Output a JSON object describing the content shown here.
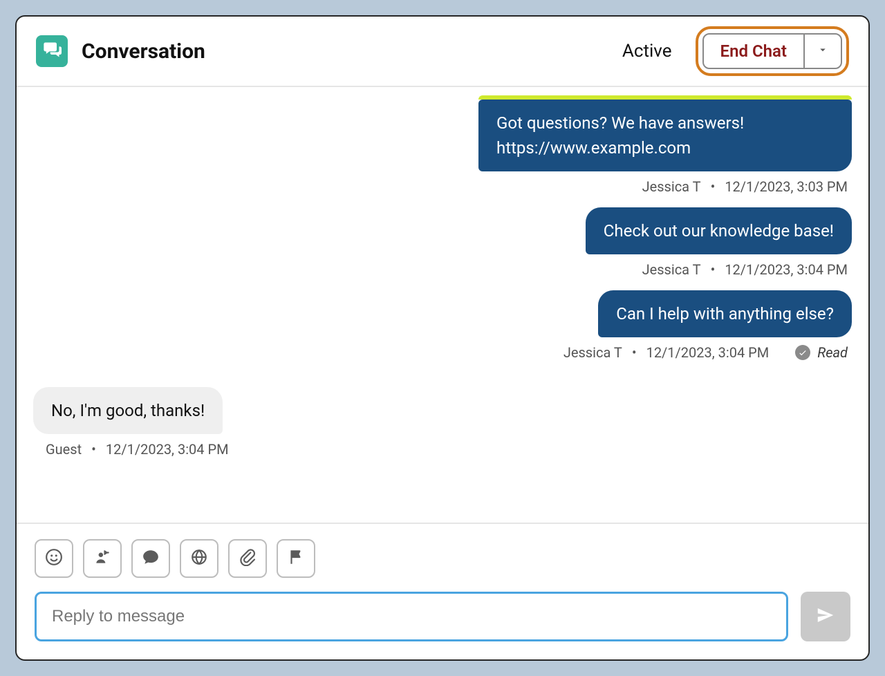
{
  "header": {
    "title": "Conversation",
    "status": "Active",
    "end_chat_label": "End Chat"
  },
  "messages": [
    {
      "side": "agent",
      "first_top": true,
      "text": "Got questions? We have answers! https://www.example.com",
      "author": "Jessica T",
      "timestamp": "12/1/2023, 3:03 PM",
      "read": false
    },
    {
      "side": "agent",
      "text": "Check out our knowledge base!",
      "author": "Jessica T",
      "timestamp": "12/1/2023, 3:04 PM",
      "read": false
    },
    {
      "side": "agent",
      "text": "Can I help with anything else?",
      "author": "Jessica T",
      "timestamp": "12/1/2023, 3:04 PM",
      "read": true,
      "read_label": "Read"
    },
    {
      "side": "guest",
      "text": "No, I'm good, thanks!",
      "author": "Guest",
      "timestamp": "12/1/2023, 3:04 PM",
      "read": false
    }
  ],
  "composer": {
    "placeholder": "Reply to message"
  }
}
